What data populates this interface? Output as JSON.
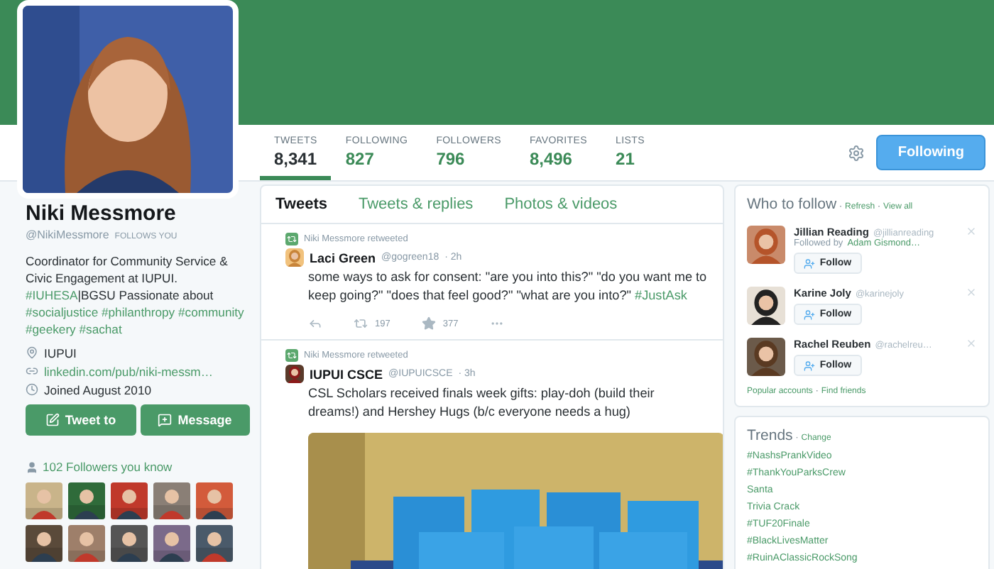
{
  "profile": {
    "name": "Niki Messmore",
    "handle": "@NikiMessmore",
    "follows_you": "FOLLOWS YOU",
    "bio": [
      {
        "kind": "text",
        "text": "Coordinator for Community Service & Civic Engagement at IUPUI. "
      },
      {
        "kind": "hashtag",
        "text": "#IUHESA"
      },
      {
        "kind": "text",
        "text": "|BGSU Passionate about "
      },
      {
        "kind": "hashtag",
        "text": "#socialjustice"
      },
      {
        "kind": "hashtag",
        "text": "#philanthropy"
      },
      {
        "kind": "hashtag",
        "text": "#community"
      },
      {
        "kind": "hashtag",
        "text": "#geekery"
      },
      {
        "kind": "hashtag",
        "text": "#sachat"
      }
    ],
    "details": [
      {
        "kind": "location",
        "text": "IUPUI"
      },
      {
        "kind": "link",
        "text": "linkedin.com/pub/niki-messm…"
      },
      {
        "kind": "joined",
        "text": "Joined August 2010"
      }
    ],
    "buttons": [
      {
        "kind": "tweet",
        "label": "Tweet to"
      },
      {
        "kind": "message",
        "label": "Message"
      }
    ],
    "followers_you_know": "102 Followers you know",
    "follower_avatars": [
      {
        "kind": "picture"
      },
      {
        "kind": "picture"
      },
      {
        "kind": "picture"
      },
      {
        "kind": "picture"
      },
      {
        "kind": "picture"
      },
      {
        "kind": "picture"
      },
      {
        "kind": "picture"
      },
      {
        "kind": "picture"
      },
      {
        "kind": "picture"
      },
      {
        "kind": "picture"
      }
    ]
  },
  "stats": [
    {
      "label": "TWEETS",
      "value": "8,341",
      "selected": true
    },
    {
      "label": "FOLLOWING",
      "value": "827",
      "selected": false
    },
    {
      "label": "FOLLOWERS",
      "value": "796",
      "selected": false
    },
    {
      "label": "FAVORITES",
      "value": "8,496",
      "selected": false
    },
    {
      "label": "LISTS",
      "value": "21",
      "selected": false
    }
  ],
  "follow_button": "Following",
  "tabs": [
    {
      "label": "Tweets",
      "selected": true
    },
    {
      "label": "Tweets & replies",
      "selected": false
    },
    {
      "label": "Photos & videos",
      "selected": false
    }
  ],
  "tweets": [
    {
      "retweeted_by": "Niki Messmore retweeted",
      "author": "Laci Green",
      "handle": "@gogreen18",
      "time": "· 2h",
      "text": [
        {
          "kind": "text",
          "text": "some ways to ask for consent: \"are you into this?\" \"do you want me to keep going?\" \"does that feel good?\" \"what are you into?\" "
        },
        {
          "kind": "hashtag",
          "text": "#JustAsk"
        }
      ],
      "retweets": "197",
      "favorites": "377"
    },
    {
      "retweeted_by": "Niki Messmore retweeted",
      "author": "IUPUI CSCE",
      "handle": "@IUPUICSCE",
      "time": "· 3h",
      "text": [
        {
          "kind": "text",
          "text": "CSL Scholars received finals week gifts: play-doh (build their dreams!) and Hershey Hugs (b/c everyone needs a hug)"
        }
      ],
      "media": {
        "kind": "picture"
      }
    }
  ],
  "who_to_follow": {
    "title": "Who to follow",
    "title_separators": [
      "·",
      "·"
    ],
    "refresh": "Refresh",
    "view_all": "View all",
    "accounts": [
      {
        "name": "Jillian Reading",
        "handle": "@jillianreading",
        "followed_by_prefix": "Followed by",
        "followed_by": "Adam Gismond…",
        "button": "Follow"
      },
      {
        "name": "Karine Joly",
        "handle": "@karinejoly",
        "button": "Follow"
      },
      {
        "name": "Rachel Reuben",
        "handle": "@rachelreu…",
        "button": "Follow"
      }
    ],
    "popular": "Popular accounts",
    "footer_separator": "·",
    "find_friends": "Find friends"
  },
  "trends": {
    "title": "Trends",
    "separator": "·",
    "change": "Change",
    "items": [
      "#NashsPrankVideo",
      "#ThankYouParksCrew",
      "Santa",
      "Trivia Crack",
      "#TUF20Finale",
      "#BlackLivesMatter",
      "#RuinAClassicRockSong"
    ]
  }
}
